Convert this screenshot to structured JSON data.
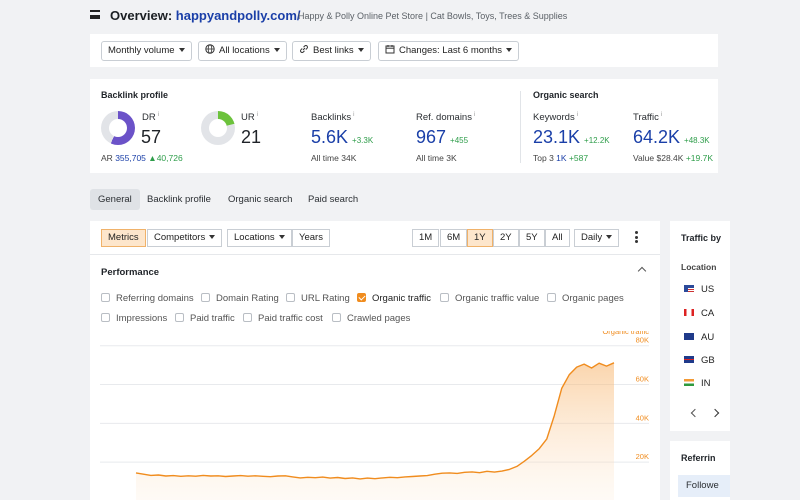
{
  "header": {
    "overview_label": "Overview:",
    "domain": "happyandpolly.com/",
    "description": "Happy & Polly Online Pet Store | Cat Bowls, Toys, Trees & Supplies"
  },
  "filters": {
    "volume": "Monthly volume",
    "locations": "All locations",
    "links": "Best links",
    "changes": "Changes: Last 6 months"
  },
  "backlink_profile": {
    "title": "Backlink profile",
    "dr": {
      "label": "DR",
      "value": "57"
    },
    "ur": {
      "label": "UR",
      "value": "21"
    },
    "ar_label": "AR",
    "ar_value": "355,705",
    "ar_delta": "▲40,726",
    "backlinks": {
      "label": "Backlinks",
      "value": "5.6K",
      "delta": "+3.3K",
      "sub_label": "All time",
      "sub_value": "34K"
    },
    "ref_domains": {
      "label": "Ref. domains",
      "value": "967",
      "delta": "+455",
      "sub_label": "All time",
      "sub_value": "3K"
    }
  },
  "organic_search": {
    "title": "Organic search",
    "keywords": {
      "label": "Keywords",
      "value": "23.1K",
      "delta": "+12.2K",
      "sub_label": "Top 3",
      "sub_value": "1K",
      "sub_delta": "+587"
    },
    "traffic": {
      "label": "Traffic",
      "value": "64.2K",
      "delta": "+48.3K",
      "sub_label": "Value",
      "sub_value": "$28.4K",
      "sub_delta": "+19.7K"
    }
  },
  "tabs": [
    "General",
    "Backlink profile",
    "Organic search",
    "Paid search"
  ],
  "toolbar": {
    "metrics": "Metrics",
    "competitors": "Competitors",
    "locations": "Locations",
    "years": "Years",
    "ranges": [
      "1M",
      "6M",
      "1Y",
      "2Y",
      "5Y",
      "All"
    ],
    "active_range": "1Y",
    "granularity": "Daily"
  },
  "performance": {
    "title": "Performance",
    "checkboxes": [
      {
        "label": "Referring domains",
        "checked": false
      },
      {
        "label": "Domain Rating",
        "checked": false
      },
      {
        "label": "URL Rating",
        "checked": false
      },
      {
        "label": "Organic traffic",
        "checked": true
      },
      {
        "label": "Organic traffic value",
        "checked": false
      },
      {
        "label": "Organic pages",
        "checked": false
      },
      {
        "label": "Impressions",
        "checked": false
      },
      {
        "label": "Paid traffic",
        "checked": false
      },
      {
        "label": "Paid traffic cost",
        "checked": false
      },
      {
        "label": "Crawled pages",
        "checked": false
      }
    ]
  },
  "chart_data": {
    "type": "area",
    "series": [
      {
        "name": "Organic traffic",
        "color": "#f08c1e",
        "values": [
          14.5,
          13.8,
          13.2,
          13.4,
          12.9,
          13.1,
          12.7,
          13.0,
          12.8,
          13.2,
          12.9,
          13.0,
          12.6,
          12.9,
          13.1,
          12.8,
          13.0,
          12.7,
          12.5,
          12.9,
          13.0,
          12.4,
          11.9,
          12.2,
          12.0,
          12.3,
          11.8,
          12.1,
          11.6,
          11.9,
          11.4,
          11.8,
          11.5,
          11.9,
          12.2,
          12.0,
          12.4,
          12.6,
          12.9,
          13.1,
          13.8,
          14.3,
          14.5,
          14.2,
          14.8,
          15.0,
          14.6,
          15.3,
          14.9,
          15.4,
          16.3,
          17.8,
          20.5,
          23.5,
          27.0,
          32.0,
          44.0,
          58.0,
          65.0,
          69.0,
          70.5,
          68.5,
          71.0,
          69.5,
          71.2
        ]
      }
    ],
    "y_axis_label": "Organic traffic",
    "y_ticks": [
      "80K",
      "60K",
      "40K",
      "20K"
    ],
    "ylim": [
      0,
      85
    ]
  },
  "traffic_by": {
    "title": "Traffic by",
    "location_label": "Location",
    "countries": [
      "US",
      "CA",
      "AU",
      "GB",
      "IN"
    ]
  },
  "referring": {
    "title": "Referrin",
    "button": "Followe"
  }
}
